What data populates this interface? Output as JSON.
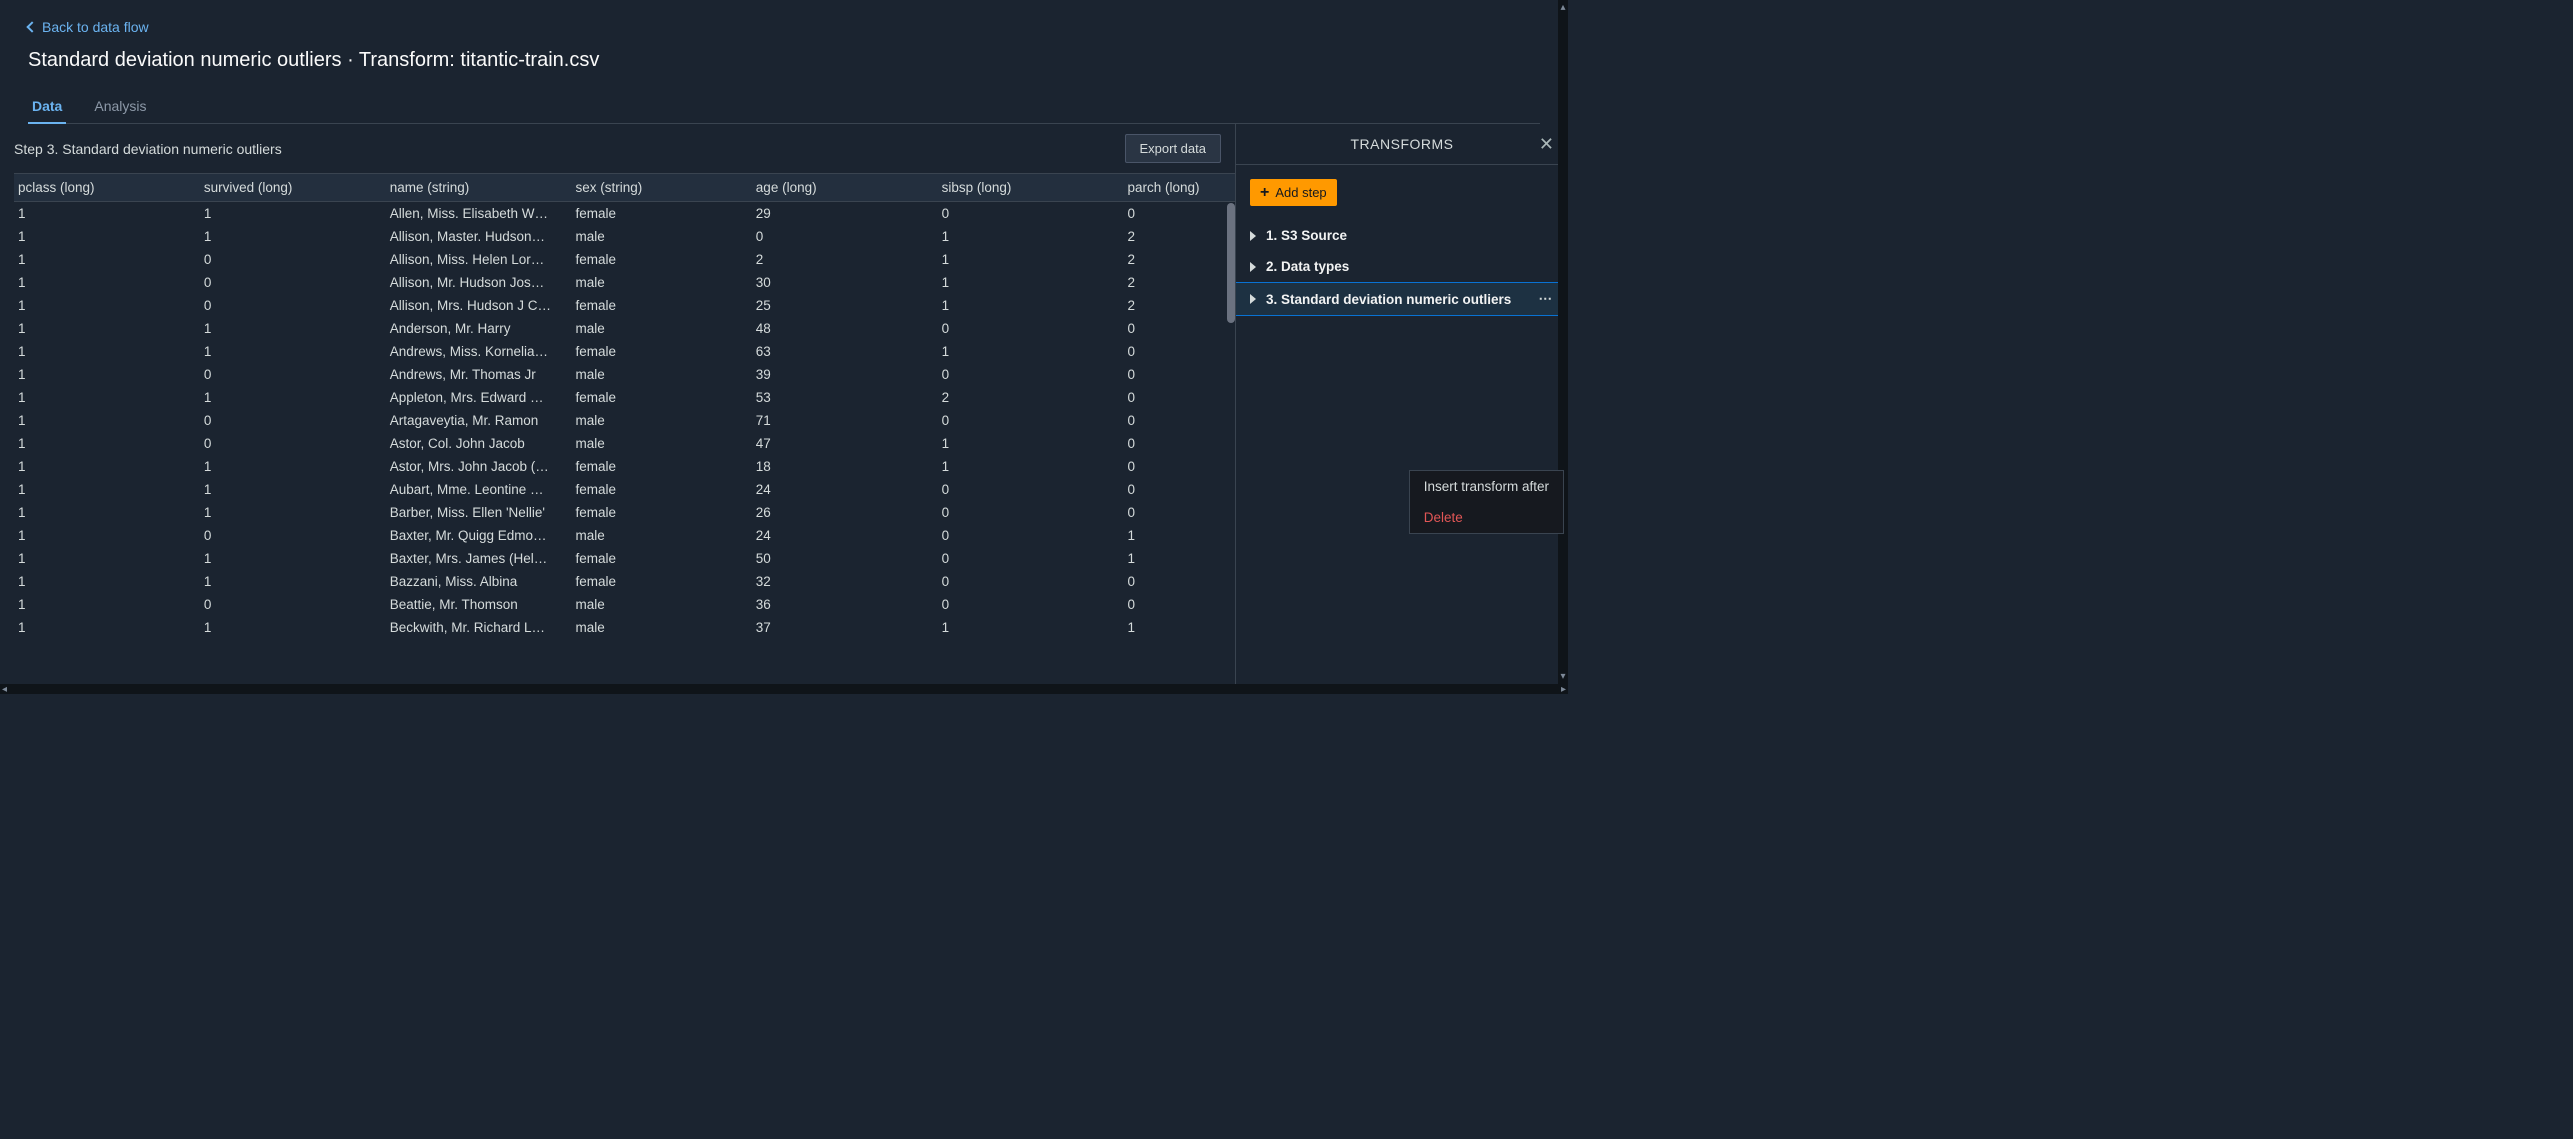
{
  "back_link": "Back to data flow",
  "page_title": "Standard deviation numeric outliers · Transform: titantic-train.csv",
  "tabs": {
    "data": "Data",
    "analysis": "Analysis"
  },
  "step_label": "Step 3. Standard deviation numeric outliers",
  "export_btn": "Export data",
  "columns": [
    "pclass (long)",
    "survived (long)",
    "name (string)",
    "sex (string)",
    "age (long)",
    "sibsp (long)",
    "parch (long)"
  ],
  "rows": [
    [
      "1",
      "1",
      "Allen, Miss. Elisabeth W…",
      "female",
      "29",
      "0",
      "0"
    ],
    [
      "1",
      "1",
      "Allison, Master. Hudson…",
      "male",
      "0",
      "1",
      "2"
    ],
    [
      "1",
      "0",
      "Allison, Miss. Helen Lor…",
      "female",
      "2",
      "1",
      "2"
    ],
    [
      "1",
      "0",
      "Allison, Mr. Hudson Jos…",
      "male",
      "30",
      "1",
      "2"
    ],
    [
      "1",
      "0",
      "Allison, Mrs. Hudson J C…",
      "female",
      "25",
      "1",
      "2"
    ],
    [
      "1",
      "1",
      "Anderson, Mr. Harry",
      "male",
      "48",
      "0",
      "0"
    ],
    [
      "1",
      "1",
      "Andrews, Miss. Kornelia…",
      "female",
      "63",
      "1",
      "0"
    ],
    [
      "1",
      "0",
      "Andrews, Mr. Thomas Jr",
      "male",
      "39",
      "0",
      "0"
    ],
    [
      "1",
      "1",
      "Appleton, Mrs. Edward …",
      "female",
      "53",
      "2",
      "0"
    ],
    [
      "1",
      "0",
      "Artagaveytia, Mr. Ramon",
      "male",
      "71",
      "0",
      "0"
    ],
    [
      "1",
      "0",
      "Astor, Col. John Jacob",
      "male",
      "47",
      "1",
      "0"
    ],
    [
      "1",
      "1",
      "Astor, Mrs. John Jacob (…",
      "female",
      "18",
      "1",
      "0"
    ],
    [
      "1",
      "1",
      "Aubart, Mme. Leontine …",
      "female",
      "24",
      "0",
      "0"
    ],
    [
      "1",
      "1",
      "Barber, Miss. Ellen 'Nellie'",
      "female",
      "26",
      "0",
      "0"
    ],
    [
      "1",
      "0",
      "Baxter, Mr. Quigg Edmo…",
      "male",
      "24",
      "0",
      "1"
    ],
    [
      "1",
      "1",
      "Baxter, Mrs. James (Hel…",
      "female",
      "50",
      "0",
      "1"
    ],
    [
      "1",
      "1",
      "Bazzani, Miss. Albina",
      "female",
      "32",
      "0",
      "0"
    ],
    [
      "1",
      "0",
      "Beattie, Mr. Thomson",
      "male",
      "36",
      "0",
      "0"
    ],
    [
      "1",
      "1",
      "Beckwith, Mr. Richard L…",
      "male",
      "37",
      "1",
      "1"
    ]
  ],
  "transforms_title": "TRANSFORMS",
  "add_step": "Add step",
  "steps": [
    "1. S3 Source",
    "2. Data types",
    "3. Standard deviation numeric outliers"
  ],
  "context_menu": {
    "insert": "Insert transform after",
    "delete": "Delete"
  }
}
